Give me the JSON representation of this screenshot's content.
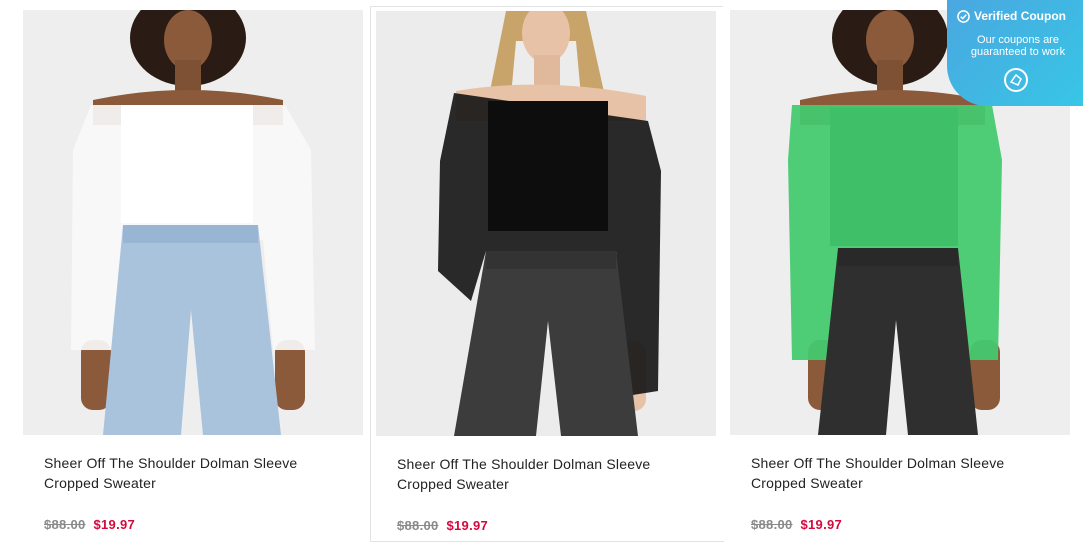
{
  "products": [
    {
      "title": "Sheer Off The Shoulder Dolman Sleeve Cropped Sweater",
      "price_old": "$88.00",
      "price_new": "$19.97",
      "color": "#ffffff"
    },
    {
      "title": "Sheer Off The Shoulder Dolman Sleeve Cropped Sweater",
      "price_old": "$88.00",
      "price_new": "$19.97",
      "color": "#111111"
    },
    {
      "title": "Sheer Off The Shoulder Dolman Sleeve Cropped Sweater",
      "price_old": "$88.00",
      "price_new": "$19.97",
      "color": "#3cc46a"
    }
  ],
  "coupon": {
    "title": "Verified Coupon",
    "subtitle": "Our coupons are guaranteed to work",
    "icon": "check-circle-icon"
  },
  "colors": {
    "sale": "#d4083b",
    "strike": "#8a8a8a",
    "coupon_bg": "#3fb6e3"
  }
}
